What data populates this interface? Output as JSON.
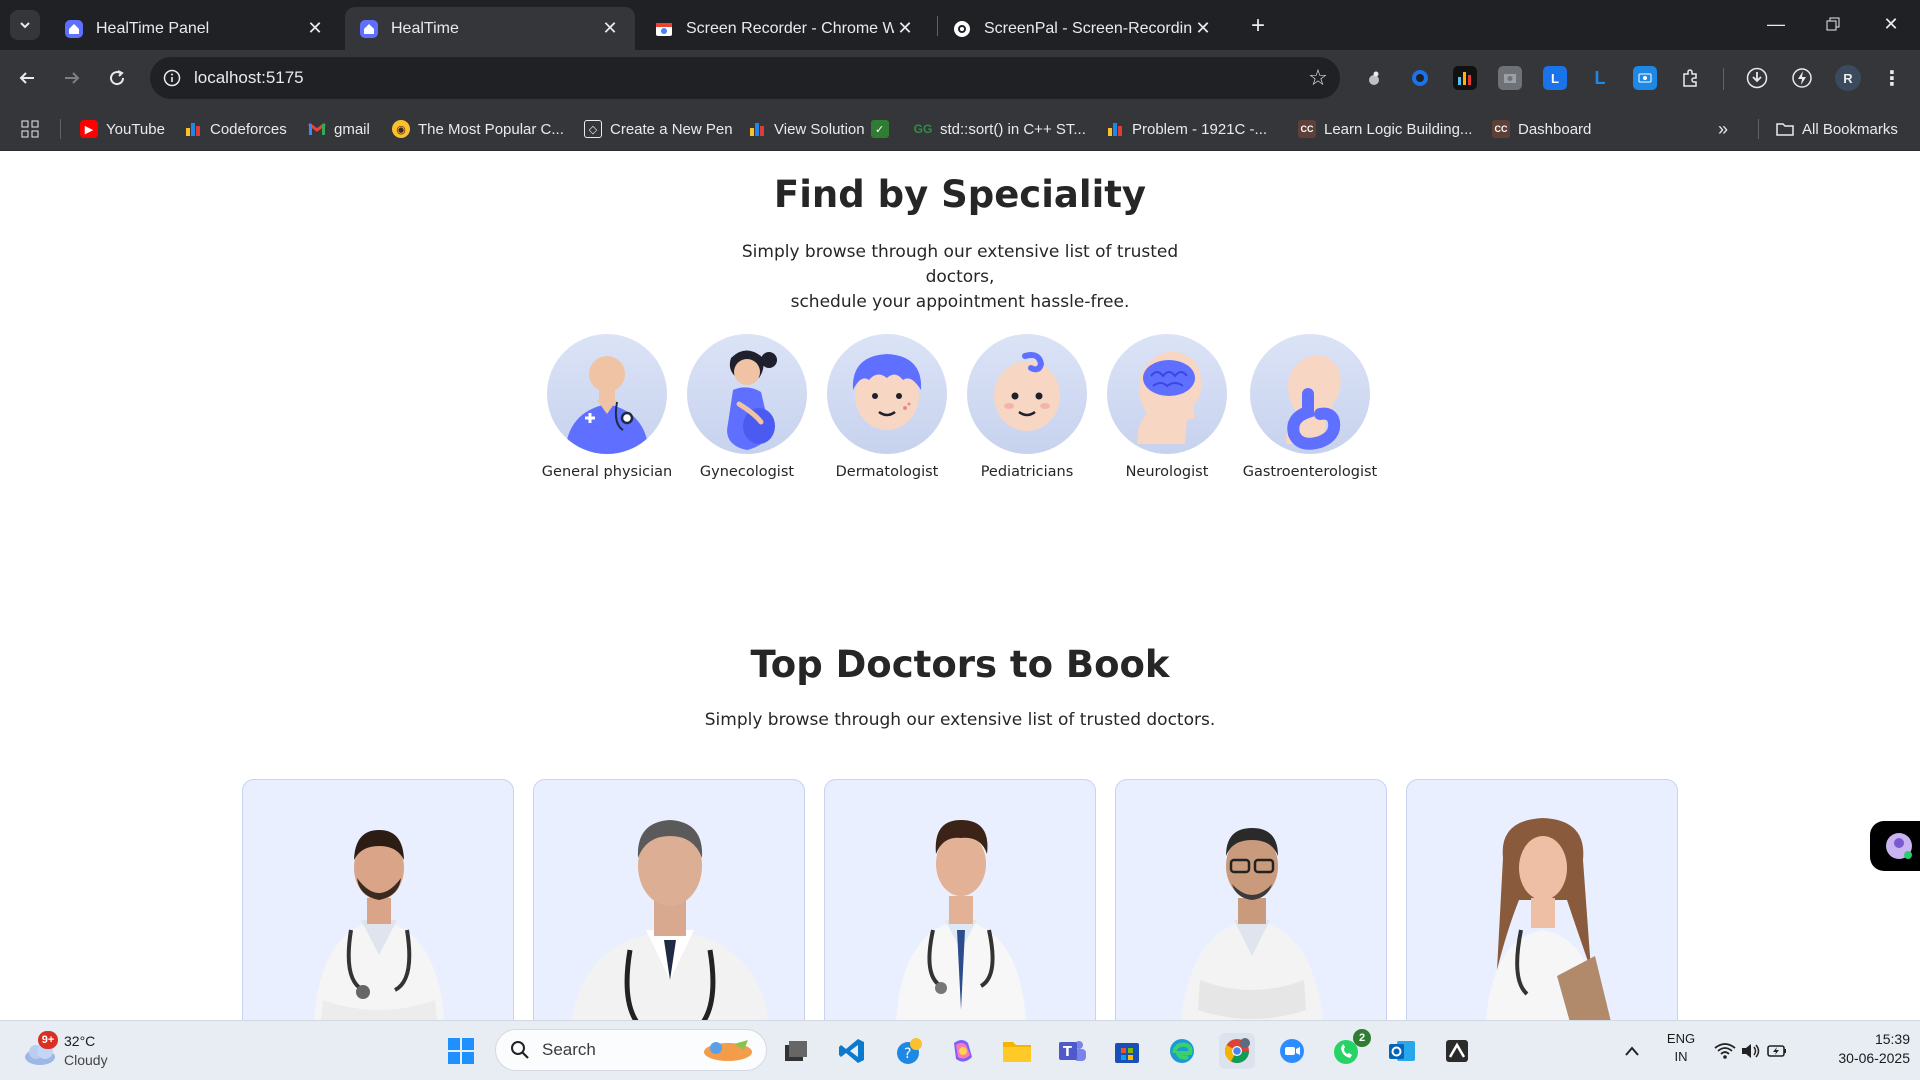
{
  "browser": {
    "tabs": [
      {
        "title": "HealTime Panel",
        "active": false
      },
      {
        "title": "HealTime",
        "active": true
      },
      {
        "title": "Screen Recorder - Chrome Web",
        "active": false
      },
      {
        "title": "ScreenPal - Screen-Recording",
        "active": false
      }
    ],
    "url": "localhost:5175",
    "profile_initial": "R",
    "bookmarks": [
      {
        "label": "YouTube",
        "icon": "youtube-icon"
      },
      {
        "label": "Codeforces",
        "icon": "codeforces-icon"
      },
      {
        "label": "gmail",
        "icon": "gmail-icon"
      },
      {
        "label": "The Most Popular C...",
        "icon": "bee-icon"
      },
      {
        "label": "Create a New Pen",
        "icon": "codepen-icon"
      },
      {
        "label": "View Solution",
        "icon": "codeforces-icon"
      },
      {
        "label": "std::sort() in C++ ST...",
        "icon": "geeksforgeeks-icon"
      },
      {
        "label": "Problem - 1921C -...",
        "icon": "codeforces-icon"
      },
      {
        "label": "Learn Logic Building...",
        "icon": "codechef-icon"
      },
      {
        "label": "Dashboard",
        "icon": "codechef-icon"
      }
    ],
    "all_bookmarks_label": "All Bookmarks"
  },
  "page": {
    "speciality": {
      "title": "Find by Speciality",
      "subtitle_line1": "Simply browse through our extensive list of trusted doctors,",
      "subtitle_line2": "schedule your appointment hassle-free.",
      "items": [
        {
          "label": "General physician",
          "icon": "general-physician-icon"
        },
        {
          "label": "Gynecologist",
          "icon": "gynecologist-icon"
        },
        {
          "label": "Dermatologist",
          "icon": "dermatologist-icon"
        },
        {
          "label": "Pediatricians",
          "icon": "pediatrician-icon"
        },
        {
          "label": "Neurologist",
          "icon": "neurologist-icon"
        },
        {
          "label": "Gastroenterologist",
          "icon": "gastroenterologist-icon"
        }
      ]
    },
    "top_doctors": {
      "title": "Top Doctors to Book",
      "subtitle": "Simply browse through our extensive list of trusted doctors."
    }
  },
  "taskbar": {
    "weather_temp": "32°C",
    "weather_desc": "Cloudy",
    "weather_badge": "9+",
    "search_label": "Search",
    "teams_badge": "",
    "whatsapp_badge": "2",
    "lang_line1": "ENG",
    "lang_line2": "IN",
    "time": "15:39",
    "date": "30-06-2025"
  },
  "colors": {
    "accent": "#5f6fff",
    "card_bg": "#eaefff",
    "chrome_dark": "#202124",
    "chrome_toolbar": "#35363a"
  }
}
